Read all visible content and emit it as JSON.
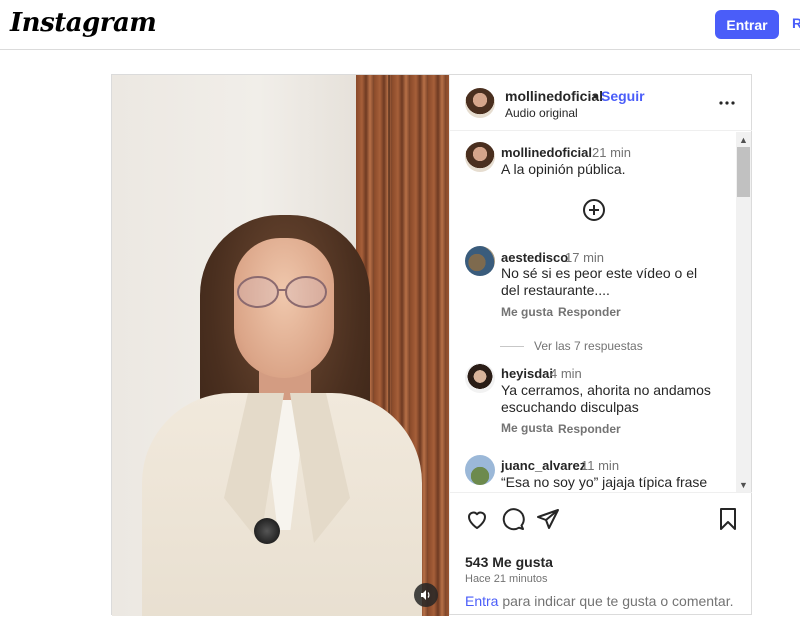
{
  "topbar": {
    "logo": "Instagram",
    "login_label": "Entrar",
    "register_label": "R"
  },
  "post": {
    "author": "mollinedoficial",
    "dot": "•",
    "follow_label": "Seguir",
    "audio": "Audio original",
    "caption": {
      "user": "mollinedoficial",
      "time": "21 min",
      "text": "A la opinión pública."
    },
    "comments": [
      {
        "user": "aestedisco",
        "time": "17 min",
        "text": "No sé si es peor este vídeo o el del restaurante....",
        "like_label": "Me gusta",
        "reply_label": "Responder",
        "view_replies": "Ver las 7 respuestas"
      },
      {
        "user": "heyisdai",
        "time": "4 min",
        "text": "Ya cerramos, ahorita no andamos escuchando disculpas",
        "like_label": "Me gusta",
        "reply_label": "Responder"
      },
      {
        "user": "juanc_alvarez",
        "time": "11 min",
        "text": "“Esa no soy yo” jajaja típica frase que"
      }
    ],
    "likes": "543 Me gusta",
    "posted": "Hace 21 minutos",
    "footer": {
      "login_link": "Entra",
      "rest": " para indicar que te gusta o comentar."
    }
  },
  "icons": {
    "more": "more-options-icon",
    "load_more": "plus-circle-icon",
    "like": "heart-icon",
    "comment": "comment-icon",
    "share": "send-icon",
    "save": "bookmark-icon",
    "volume": "speaker-icon"
  },
  "colors": {
    "accent": "#4a5df9",
    "text": "#262626",
    "secondary": "#737373"
  }
}
